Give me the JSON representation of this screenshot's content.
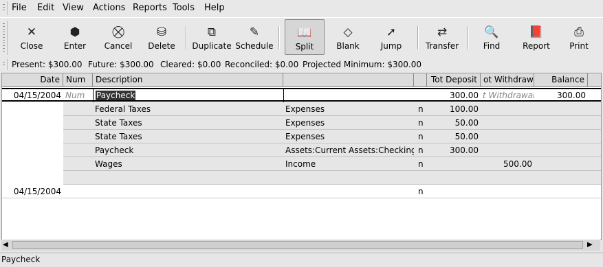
{
  "menu": [
    "File",
    "Edit",
    "View",
    "Actions",
    "Reports",
    "Tools",
    "Help"
  ],
  "toolbar": [
    {
      "label": "Close",
      "icon": "✕",
      "icon_name": "close-icon"
    },
    {
      "label": "Enter",
      "icon": "⬢",
      "icon_name": "enter-icon"
    },
    {
      "label": "Cancel",
      "icon": "⛒",
      "icon_name": "cancel-icon"
    },
    {
      "label": "Delete",
      "icon": "⛁",
      "icon_name": "delete-icon"
    },
    {
      "label": "Duplicate",
      "icon": "⧉",
      "icon_name": "duplicate-icon"
    },
    {
      "label": "Schedule",
      "icon": "✎",
      "icon_name": "schedule-icon"
    },
    {
      "label": "Split",
      "icon": "📖",
      "icon_name": "split-icon"
    },
    {
      "label": "Blank",
      "icon": "◇",
      "icon_name": "blank-icon"
    },
    {
      "label": "Jump",
      "icon": "➚",
      "icon_name": "jump-icon"
    },
    {
      "label": "Transfer",
      "icon": "⇄",
      "icon_name": "transfer-icon"
    },
    {
      "label": "Find",
      "icon": "🔍",
      "icon_name": "find-icon"
    },
    {
      "label": "Report",
      "icon": "📕",
      "icon_name": "report-icon"
    },
    {
      "label": "Print",
      "icon": "⎙",
      "icon_name": "print-icon"
    }
  ],
  "summary": {
    "present": "Present: $300.00",
    "future": "Future: $300.00",
    "cleared": "Cleared: $0.00",
    "reconciled": "Reconciled: $0.00",
    "projected": "Projected Minimum: $300.00"
  },
  "columns": {
    "date": "Date",
    "num": "Num",
    "description": "Description",
    "account": "",
    "rec": "",
    "deposit": "Tot Deposit",
    "withdrawal": "ot Withdrawal",
    "balance": "Balance"
  },
  "transaction": {
    "date": "04/15/2004",
    "num": "Num",
    "description": "Paycheck",
    "deposit": "300.00",
    "withdrawal": "t Withdrawal",
    "balance": "300.00"
  },
  "splits": [
    {
      "memo": "Federal Taxes",
      "account": "Expenses",
      "rec": "n",
      "deposit": "100.00",
      "withdrawal": ""
    },
    {
      "memo": "State Taxes",
      "account": "Expenses",
      "rec": "n",
      "deposit": "50.00",
      "withdrawal": ""
    },
    {
      "memo": "State Taxes",
      "account": "Expenses",
      "rec": "n",
      "deposit": "50.00",
      "withdrawal": ""
    },
    {
      "memo": "Paycheck",
      "account": "Assets:Current Assets:Checking A",
      "rec": "n",
      "deposit": "300.00",
      "withdrawal": ""
    },
    {
      "memo": "Wages",
      "account": "Income",
      "rec": "n",
      "deposit": "",
      "withdrawal": "500.00"
    },
    {
      "memo": "",
      "account": "",
      "rec": "",
      "deposit": "",
      "withdrawal": ""
    }
  ],
  "blank_transaction": {
    "date": "04/15/2004",
    "rec": "n"
  },
  "status_bar": "Paycheck"
}
